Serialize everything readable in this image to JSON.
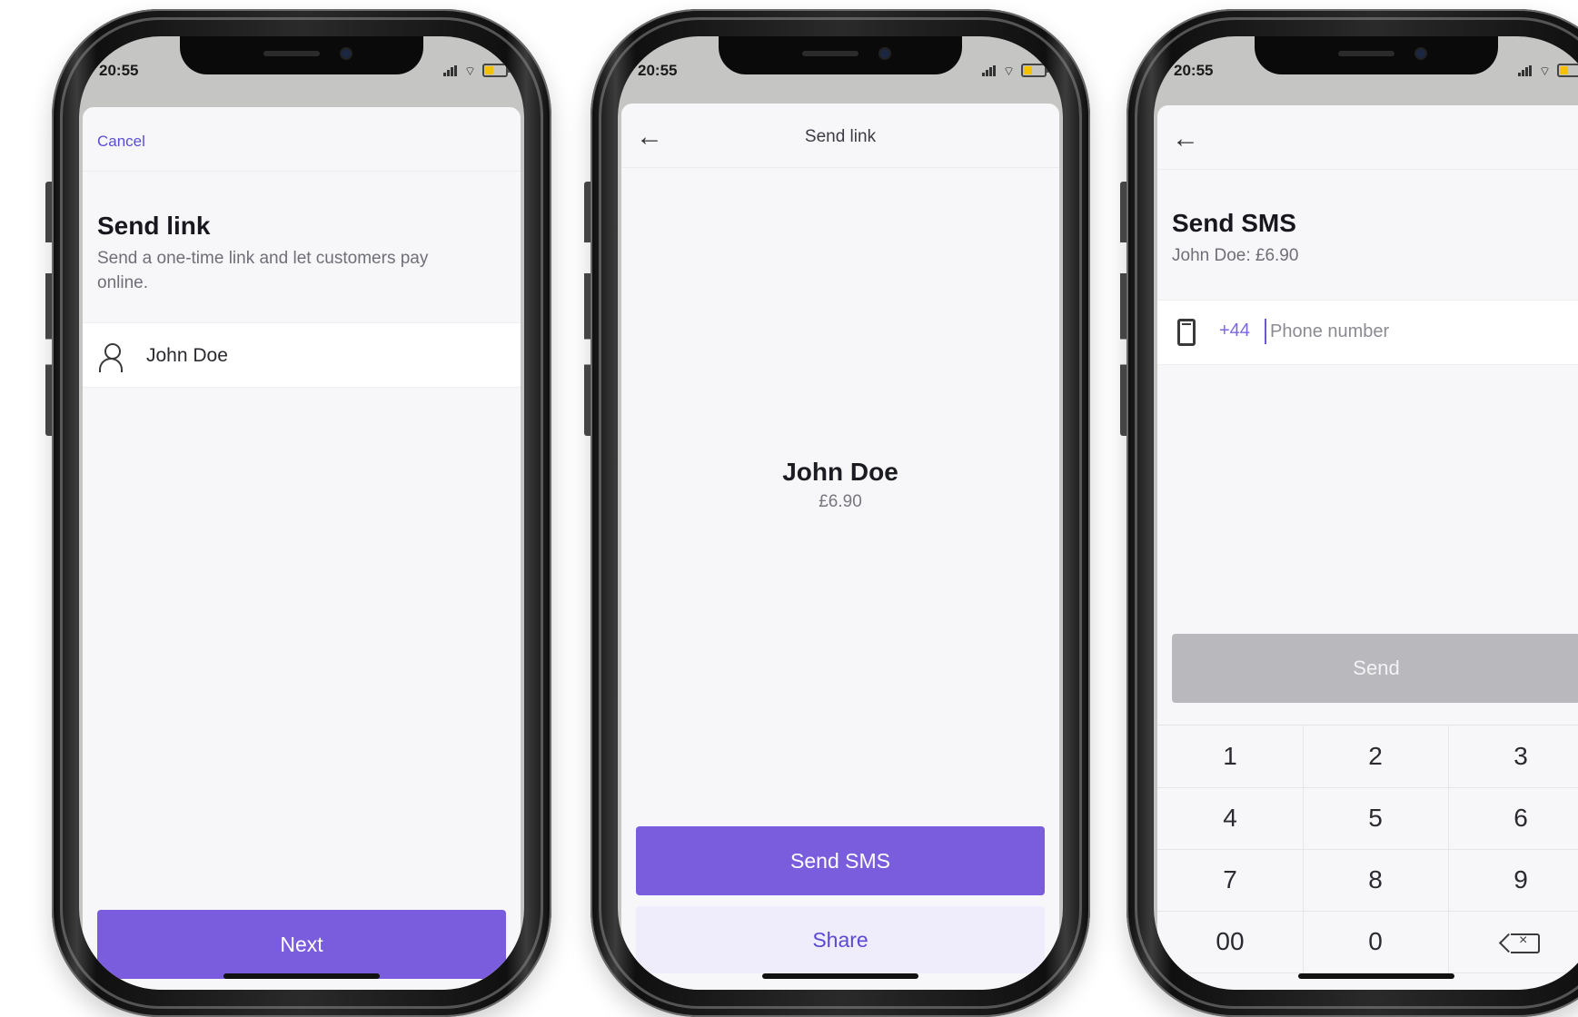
{
  "status_time": "20:55",
  "screen1": {
    "cancel_label": "Cancel",
    "title": "Send link",
    "description": "Send a one-time link and let customers pay online.",
    "customer_name": "John Doe",
    "next_label": "Next"
  },
  "screen2": {
    "nav_title": "Send link",
    "customer_name": "John Doe",
    "amount": "£6.90",
    "send_sms_label": "Send SMS",
    "share_label": "Share"
  },
  "screen3": {
    "title": "Send SMS",
    "subtitle": "John Doe: £6.90",
    "country_code": "+44",
    "phone_placeholder": "Phone number",
    "send_label": "Send",
    "keypad": [
      "1",
      "2",
      "3",
      "4",
      "5",
      "6",
      "7",
      "8",
      "9",
      "00",
      "0"
    ]
  },
  "icons": {
    "back": "back-arrow-icon",
    "person": "person-icon",
    "phone": "phone-icon",
    "backspace": "backspace-icon"
  },
  "colors": {
    "accent": "#7a5ddd",
    "accent_soft": "#efedfb",
    "link": "#5a4ed1",
    "disabled": "#b9b9bd"
  }
}
